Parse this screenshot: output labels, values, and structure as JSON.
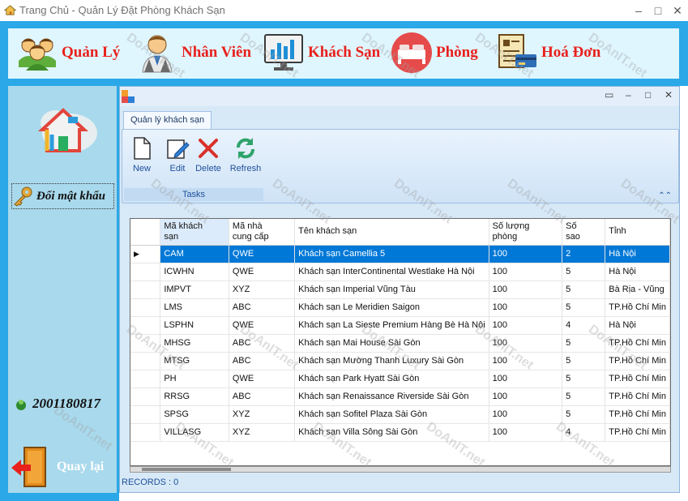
{
  "window": {
    "title": "Trang Chủ - Quản Lý Đặt Phòng Khách Sạn",
    "controls": [
      "–",
      "□",
      "✕"
    ]
  },
  "nav": {
    "items": [
      {
        "label": "Quản Lý",
        "icon": "users-group-icon"
      },
      {
        "label": "Nhân Viên",
        "icon": "employee-icon"
      },
      {
        "label": "Khách Sạn",
        "icon": "chart-monitor-icon"
      },
      {
        "label": "Phòng",
        "icon": "bed-icon"
      },
      {
        "label": "Hoá Đơn",
        "icon": "invoice-icon"
      }
    ]
  },
  "sidebar": {
    "change_password": "Đổi mật khẩu",
    "user_id": "2001180817",
    "back": "Quay lại"
  },
  "child": {
    "controls": [
      "▭",
      "–",
      "□",
      "✕"
    ],
    "tab": "Quản lý khách sạn",
    "buttons": [
      {
        "label": "New",
        "icon": "new-file-icon"
      },
      {
        "label": "Edit",
        "icon": "edit-icon"
      },
      {
        "label": "Delete",
        "icon": "delete-icon"
      },
      {
        "label": "Refresh",
        "icon": "refresh-icon"
      }
    ],
    "group_label": "Tasks",
    "records": "RECORDS : 0"
  },
  "grid": {
    "columns": [
      "Mã khách\nsạn",
      "Mã nhà\ncung cấp",
      "Tên khách sạn",
      "Số lượng\nphòng",
      "Số\nsao",
      "Tỉnh"
    ],
    "rows": [
      [
        "CAM",
        "QWE",
        "Khách sạn Camellia 5",
        "100",
        "2",
        "Hà Nội"
      ],
      [
        "ICWHN",
        "QWE",
        "Khách sạn InterContinental Westlake Hà Nội",
        "100",
        "5",
        "Hà Nội"
      ],
      [
        "IMPVT",
        "XYZ",
        "Khách sạn Imperial Vũng Tàu",
        "100",
        "5",
        "Bà Rịa - Vũng"
      ],
      [
        "LMS",
        "ABC",
        "Khách sạn Le Meridien Saigon",
        "100",
        "5",
        "TP.Hồ Chí Min"
      ],
      [
        "LSPHN",
        "QWE",
        "Khách sạn La Sieste Premium Hàng Bè Hà Nội",
        "100",
        "4",
        "Hà Nội"
      ],
      [
        "MHSG",
        "ABC",
        "Khách sạn Mai House Sài Gòn",
        "100",
        "5",
        "TP.Hồ Chí Min"
      ],
      [
        "MTSG",
        "ABC",
        "Khách sạn Mường Thanh Luxury Sài Gòn",
        "100",
        "5",
        "TP.Hồ Chí Min"
      ],
      [
        "PH",
        "QWE",
        "Khách sạn Park Hyatt Sài Gòn",
        "100",
        "5",
        "TP.Hồ Chí Min"
      ],
      [
        "RRSG",
        "ABC",
        "Khách sạn Renaissance Riverside Sài Gòn",
        "100",
        "5",
        "TP.Hồ Chí Min"
      ],
      [
        "SPSG",
        "XYZ",
        "Khách sạn Sofitel Plaza Sài Gòn",
        "100",
        "5",
        "TP.Hồ Chí Min"
      ],
      [
        "VILLASG",
        "XYZ",
        "Khách sạn Villa Sông Sài Gòn",
        "100",
        "4",
        "TP.Hồ Chí Min"
      ]
    ],
    "selected_row": 0
  },
  "watermark": "DoAnIT.net",
  "colors": {
    "nav_band": "#2aa8e8",
    "nav_inner": "#dff6ff",
    "nav_text": "#e8211c",
    "sidebar_inner": "#a9d9ec",
    "selection": "#0078d7"
  }
}
